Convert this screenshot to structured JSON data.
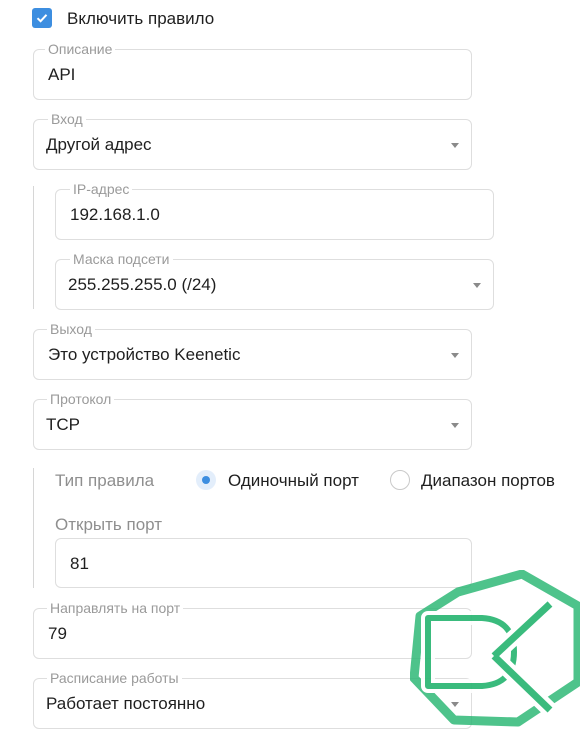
{
  "enable_rule": {
    "label": "Включить правило",
    "checked": true
  },
  "description": {
    "label": "Описание",
    "value": "API"
  },
  "input": {
    "label": "Вход",
    "value": "Другой адрес"
  },
  "ip_address": {
    "label": "IP-адрес",
    "value": "192.168.1.0"
  },
  "subnet_mask": {
    "label": "Маска подсети",
    "value": "255.255.255.0 (/24)"
  },
  "output": {
    "label": "Выход",
    "value": "Это устройство Keenetic"
  },
  "protocol": {
    "label": "Протокол",
    "value": "TCP"
  },
  "rule_type": {
    "label": "Тип правила",
    "options": [
      "Одиночный порт",
      "Диапазон портов"
    ],
    "selected": "Одиночный порт"
  },
  "open_port": {
    "label": "Открыть порт",
    "value": "81"
  },
  "forward_port": {
    "label": "Направлять на порт",
    "value": "79"
  },
  "schedule": {
    "label": "Расписание работы",
    "value": "Работает постоянно"
  },
  "colors": {
    "accent": "#3d8ee0",
    "watermark": "#2ab673"
  },
  "icons": [
    "checkmark-icon",
    "chevron-down-icon",
    "watermark-logo"
  ]
}
